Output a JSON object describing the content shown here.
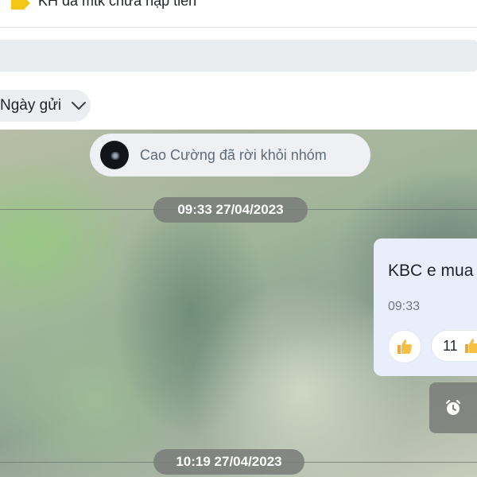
{
  "header": {
    "title": "KH đã mtk chưa nạp tiền",
    "tag_icon": "tag-icon",
    "tag_color": "#f5c518"
  },
  "search": {
    "value": ""
  },
  "filter": {
    "label": "Ngày gửi",
    "icon": "chevron-down-icon"
  },
  "chat": {
    "system_message": "Cao Cường đã rời khỏi nhóm",
    "dates": [
      "09:33 27/04/2023",
      "10:19 27/04/2023"
    ],
    "message": {
      "text": "KBC e mua",
      "time": "09:33",
      "reactions": [
        {
          "icon": "thumbs-up-icon",
          "count": ""
        },
        {
          "icon": "thumbs-up-icon",
          "count": "11"
        }
      ]
    },
    "alarm_icon": "alarm-clock-icon"
  }
}
